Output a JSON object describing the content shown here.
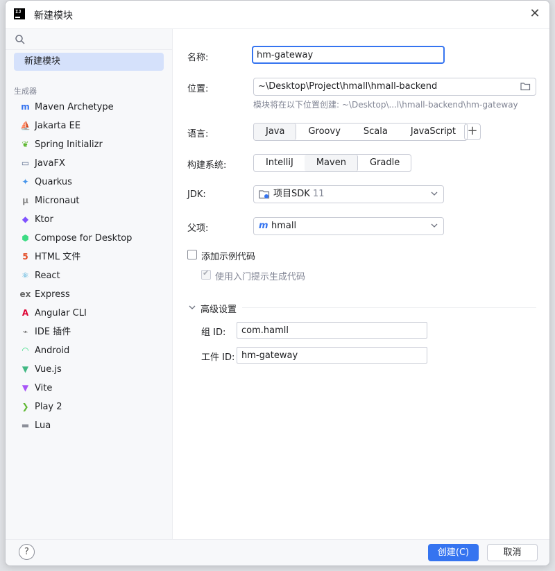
{
  "window": {
    "title": "新建模块"
  },
  "sidebar": {
    "selected": "新建模块",
    "section_label": "生成器",
    "generators": [
      {
        "label": "Maven Archetype",
        "icon": "maven-icon",
        "glyph": "m",
        "color": "#3574f0"
      },
      {
        "label": "Jakarta EE",
        "icon": "jakarta-ee-icon",
        "glyph": "⛵",
        "color": "#f2a100"
      },
      {
        "label": "Spring Initializr",
        "icon": "spring-icon",
        "glyph": "❦",
        "color": "#5fb832"
      },
      {
        "label": "JavaFX",
        "icon": "javafx-icon",
        "glyph": "▭",
        "color": "#5a6b8c"
      },
      {
        "label": "Quarkus",
        "icon": "quarkus-icon",
        "glyph": "✦",
        "color": "#4695eb"
      },
      {
        "label": "Micronaut",
        "icon": "micronaut-icon",
        "glyph": "μ",
        "color": "#888888"
      },
      {
        "label": "Ktor",
        "icon": "ktor-icon",
        "glyph": "◆",
        "color": "#7f52ff"
      },
      {
        "label": "Compose for Desktop",
        "icon": "compose-icon",
        "glyph": "⬢",
        "color": "#3ddc84"
      },
      {
        "label": "HTML 文件",
        "icon": "html-icon",
        "glyph": "5",
        "color": "#e44d26"
      },
      {
        "label": "React",
        "icon": "react-icon",
        "glyph": "⚛",
        "color": "#3fa9d8"
      },
      {
        "label": "Express",
        "icon": "express-icon",
        "glyph": "ex",
        "color": "#666666"
      },
      {
        "label": "Angular CLI",
        "icon": "angular-icon",
        "glyph": "A",
        "color": "#dd0031"
      },
      {
        "label": "IDE 插件",
        "icon": "plugin-icon",
        "glyph": "⌁",
        "color": "#666666"
      },
      {
        "label": "Android",
        "icon": "android-icon",
        "glyph": "◠",
        "color": "#3ddc84"
      },
      {
        "label": "Vue.js",
        "icon": "vue-icon",
        "glyph": "▼",
        "color": "#41b883"
      },
      {
        "label": "Vite",
        "icon": "vite-icon",
        "glyph": "▼",
        "color": "#a855f7"
      },
      {
        "label": "Play 2",
        "icon": "play-icon",
        "glyph": "❯",
        "color": "#5fb832"
      },
      {
        "label": "Lua",
        "icon": "lua-icon",
        "glyph": "▬",
        "color": "#8c8f99"
      }
    ]
  },
  "form": {
    "name_label": "名称:",
    "name_value": "hm-gateway",
    "location_label": "位置:",
    "location_value": "~\\Desktop\\Project\\hmall\\hmall-backend",
    "location_hint": "模块将在以下位置创建: ~\\Desktop\\...l\\hmall-backend\\hm-gateway",
    "language_label": "语言:",
    "languages": [
      "Java",
      "Groovy",
      "Scala",
      "JavaScript"
    ],
    "build_label": "构建系统:",
    "build_systems": [
      "IntelliJ",
      "Maven",
      "Gradle"
    ],
    "jdk_label": "JDK:",
    "jdk_value": "项目SDK",
    "jdk_version": "11",
    "parent_label": "父项:",
    "parent_value": "hmall",
    "sample_code_label": "添加示例代码",
    "onboarding_label": "使用入门提示生成代码",
    "advanced_label": "高级设置",
    "group_id_label": "组 ID:",
    "group_id_value": "com.hamll",
    "artifact_id_label": "工件 ID:",
    "artifact_id_value": "hm-gateway"
  },
  "footer": {
    "help": "?",
    "create": "创建(C)",
    "cancel": "取消"
  },
  "colors": {
    "accent": "#3574f0",
    "selected_bg": "#d5e1fb"
  }
}
